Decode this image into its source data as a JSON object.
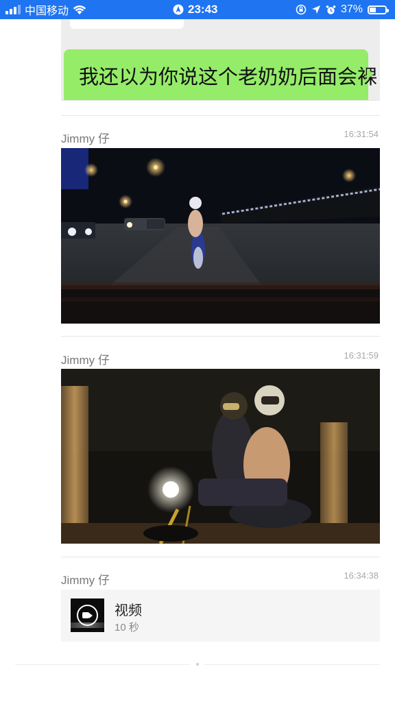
{
  "status_bar": {
    "carrier": "中国移动",
    "time": "23:43",
    "battery": "37%",
    "battery_level": 0.37,
    "icons": [
      "signal-icon",
      "wifi-icon",
      "location-arrow-icon",
      "rotation-lock-icon",
      "location-icon",
      "alarm-icon",
      "battery-icon"
    ]
  },
  "quoted_chat": {
    "green_bubble_text": "我还以为你说这个老奶奶后面会裸"
  },
  "messages": [
    {
      "sender": "Jimmy 仔",
      "time": "16:31:54",
      "type": "image"
    },
    {
      "sender": "Jimmy 仔",
      "time": "16:31:59",
      "type": "image"
    },
    {
      "sender": "Jimmy 仔",
      "time": "16:34:38",
      "type": "video",
      "title": "视频",
      "duration": "10 秒"
    }
  ],
  "colors": {
    "status_bar": "#1f74f1",
    "green_bubble": "#95ec69",
    "card_background": "#f5f5f5"
  }
}
